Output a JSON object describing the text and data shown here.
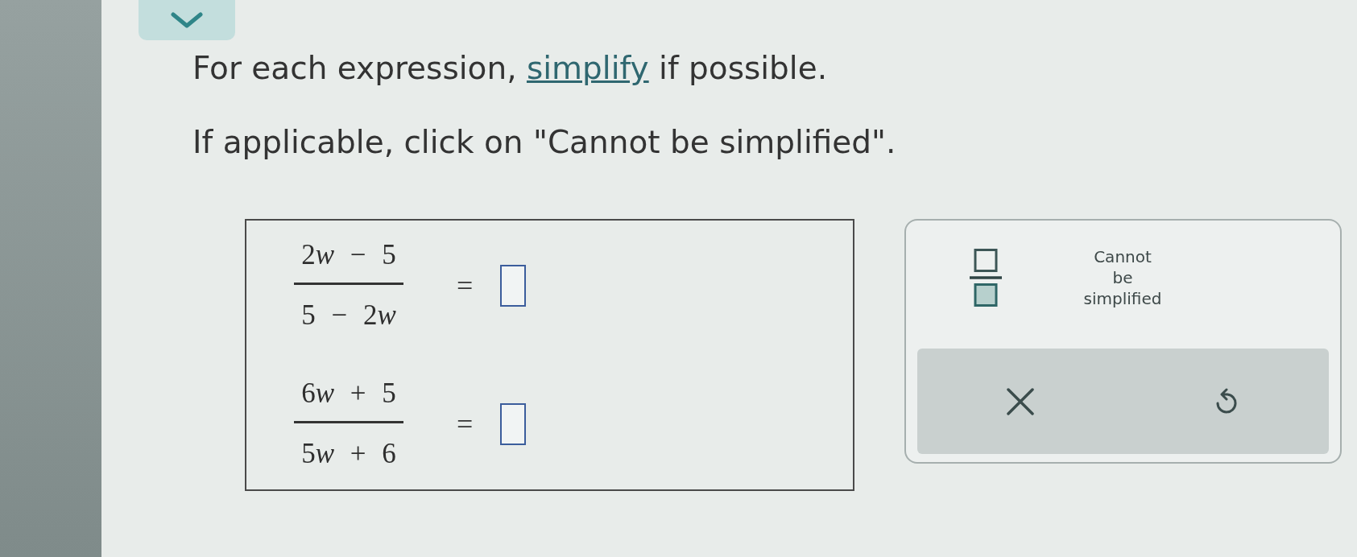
{
  "instructions": [
    {
      "parts": [
        {
          "kind": "text",
          "text": "For each expression, "
        },
        {
          "kind": "link",
          "text": "simplify"
        },
        {
          "kind": "text",
          "text": " if possible."
        }
      ]
    },
    {
      "parts": [
        {
          "kind": "text",
          "text": "If applicable, click on \"Cannot be simplified\"."
        }
      ]
    }
  ],
  "expressions": [
    {
      "numerator": [
        {
          "text": "2",
          "italic": false
        },
        {
          "text": "w",
          "italic": true
        },
        {
          "text": " − 5",
          "italic": false
        }
      ],
      "denominator": [
        {
          "text": "5 − 2",
          "italic": false
        },
        {
          "text": "w",
          "italic": true
        }
      ],
      "relation": "="
    },
    {
      "numerator": [
        {
          "text": "6",
          "italic": false
        },
        {
          "text": "w",
          "italic": true
        },
        {
          "text": " + 5",
          "italic": false
        }
      ],
      "denominator": [
        {
          "text": "5",
          "italic": false
        },
        {
          "text": "w",
          "italic": true
        },
        {
          "text": " + 6",
          "italic": false
        }
      ],
      "relation": "="
    }
  ],
  "toolbar": {
    "cannot_simplify": "Cannot be simplified"
  }
}
